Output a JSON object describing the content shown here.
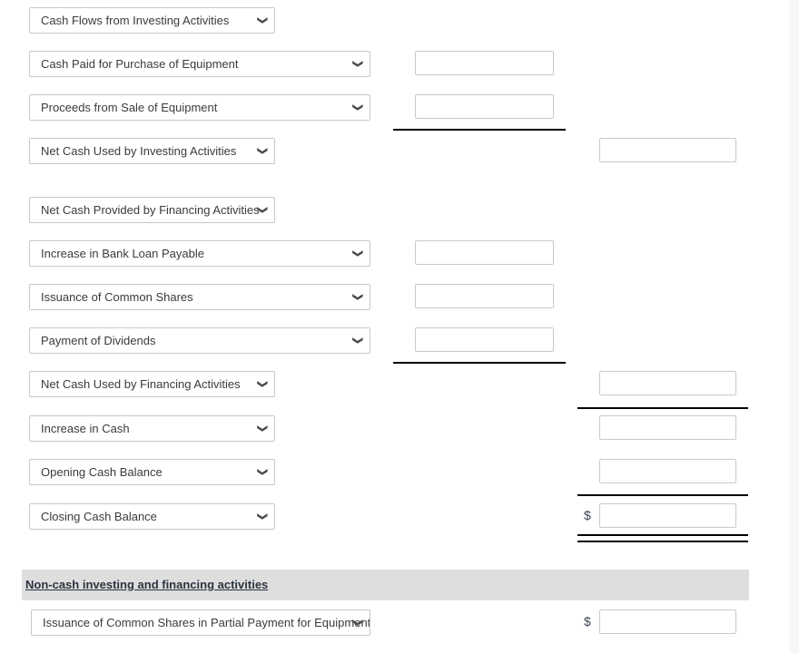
{
  "form": {
    "icons": {
      "chevron": "⌄",
      "chevron_glyph": "chevron-down-icon"
    },
    "currency_symbol": "$",
    "rows": [
      {
        "id": "cash-flows-investing-header",
        "select": {
          "label": "Cash Flows from Investing Activities",
          "width": "narrow",
          "value": ""
        },
        "mid_input": null,
        "right_input": null
      },
      {
        "id": "cash-paid-purchase-equipment",
        "select": {
          "label": "Cash Paid for Purchase of Equipment",
          "width": "wide",
          "value": ""
        },
        "mid_input": {
          "value": "",
          "placeholder": ""
        },
        "right_input": null
      },
      {
        "id": "proceeds-sale-equipment",
        "select": {
          "label": "Proceeds from Sale of Equipment",
          "width": "wide",
          "value": ""
        },
        "mid_input": {
          "value": "",
          "placeholder": ""
        },
        "right_input": null
      },
      {
        "id": "net-cash-used-investing",
        "select": {
          "label": "Net Cash Used by Investing Activities",
          "width": "narrow",
          "value": ""
        },
        "mid_input": null,
        "right_input": {
          "value": "",
          "placeholder": ""
        }
      },
      {
        "id": "net-cash-provided-financing-header",
        "select": {
          "label": "Net Cash Provided by Financing Activities",
          "width": "narrow",
          "value": ""
        },
        "mid_input": null,
        "right_input": null
      },
      {
        "id": "increase-bank-loan-payable",
        "select": {
          "label": "Increase in Bank Loan Payable",
          "width": "wide",
          "value": ""
        },
        "mid_input": {
          "value": "",
          "placeholder": ""
        },
        "right_input": null
      },
      {
        "id": "issuance-common-shares",
        "select": {
          "label": "Issuance of Common Shares",
          "width": "wide",
          "value": ""
        },
        "mid_input": {
          "value": "",
          "placeholder": ""
        },
        "right_input": null
      },
      {
        "id": "payment-of-dividends",
        "select": {
          "label": "Payment of Dividends",
          "width": "wide",
          "value": ""
        },
        "mid_input": {
          "value": "",
          "placeholder": ""
        },
        "right_input": null
      },
      {
        "id": "net-cash-used-financing",
        "select": {
          "label": "Net Cash Used by Financing Activities",
          "width": "narrow",
          "value": ""
        },
        "mid_input": null,
        "right_input": {
          "value": "",
          "placeholder": ""
        }
      },
      {
        "id": "increase-in-cash",
        "select": {
          "label": "Increase in Cash",
          "width": "narrow",
          "value": ""
        },
        "mid_input": null,
        "right_input": {
          "value": "",
          "placeholder": ""
        }
      },
      {
        "id": "opening-cash-balance",
        "select": {
          "label": "Opening Cash Balance",
          "width": "narrow",
          "value": ""
        },
        "mid_input": null,
        "right_input": {
          "value": "",
          "placeholder": ""
        }
      },
      {
        "id": "closing-cash-balance",
        "select": {
          "label": "Closing Cash Balance",
          "width": "narrow",
          "value": ""
        },
        "mid_input": null,
        "right_input": {
          "value": "",
          "placeholder": ""
        },
        "dollar": true
      }
    ],
    "section": {
      "title": "Non-cash investing and financing activities",
      "row": {
        "id": "issuance-common-shares-partial-payment",
        "select": {
          "label": "Issuance of Common Shares in Partial Payment for Equipment",
          "width": "bottom",
          "value": ""
        },
        "right_input": {
          "value": "",
          "placeholder": ""
        },
        "dollar": true
      }
    }
  },
  "colors": {
    "page_background": "#f7f7f7",
    "surface": "#ffffff",
    "band": "#dedede",
    "border": "#c8c8c8",
    "text": "#3b3b3b",
    "rule": "#000000"
  }
}
